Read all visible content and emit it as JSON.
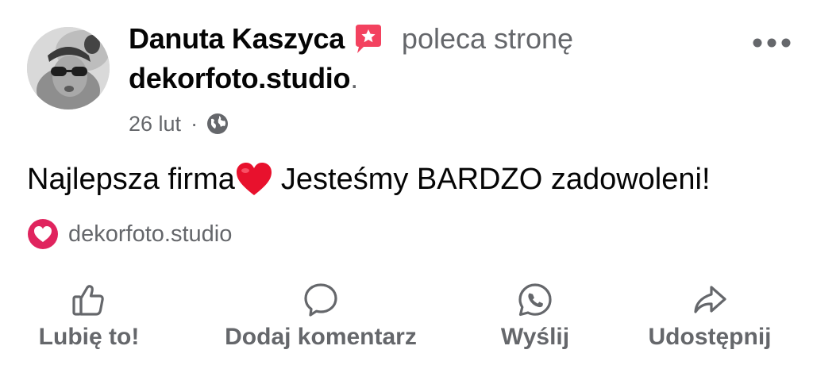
{
  "post": {
    "author": "Danuta Kaszyca",
    "action_text": "poleca stronę",
    "page_name": "dekorfoto.studio",
    "page_dot": ".",
    "date": "26 lut",
    "meta_separator": "·",
    "text_before_emoji": "Najlepsza firma",
    "text_after_emoji": "Jesteśmy BARDZO zadowoleni!",
    "tagged_page": "dekorfoto.studio"
  },
  "actions": {
    "like": "Lubię to!",
    "comment": "Dodaj komentarz",
    "send": "Wyślij",
    "share": "Udostępnij"
  },
  "icons": {
    "recommend": "recommend-star-speech-bubble-icon",
    "privacy": "globe-icon",
    "more": "more-horizontal-icon",
    "emoji": "red-heart-emoji",
    "tag": "heart-circle-icon",
    "like": "thumbs-up-icon",
    "comment": "comment-bubble-icon",
    "send": "whatsapp-icon",
    "share": "share-arrow-icon"
  },
  "colors": {
    "primary_text": "#050505",
    "secondary_text": "#65676b",
    "recommend_pink": "#f3425f",
    "heart_red": "#e0245e"
  }
}
